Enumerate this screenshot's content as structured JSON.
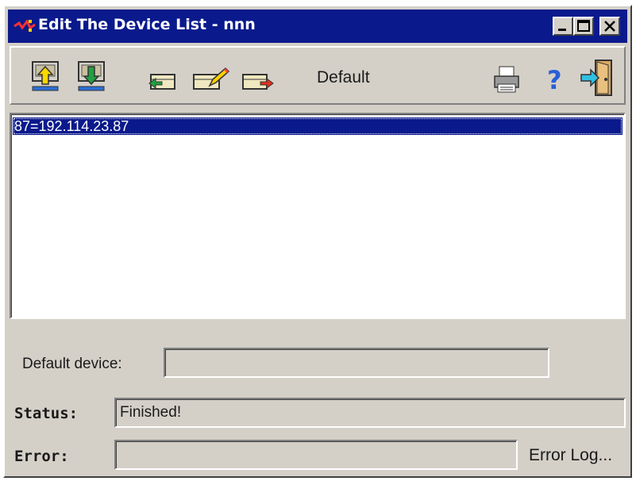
{
  "window": {
    "title": "Edit The Device List - nnn",
    "controls": {
      "minimize": "_",
      "maximize": "□",
      "close": "×"
    }
  },
  "toolbar": {
    "current_list": "Default",
    "icons": [
      "upload-icon",
      "download-icon",
      "add-device-icon",
      "edit-device-icon",
      "delete-device-icon",
      "print-icon",
      "help-icon",
      "exit-icon"
    ]
  },
  "device_list": {
    "items": [
      {
        "label": "87=192.114.23.87",
        "selected": true
      }
    ]
  },
  "form": {
    "default_device": {
      "label": "Default device:",
      "value": ""
    },
    "status": {
      "label": "Status:",
      "value": "Finished!"
    },
    "error": {
      "label": "Error:",
      "value": ""
    },
    "error_log_button": "Error Log..."
  },
  "colors": {
    "titlebar": "#0a1a8c",
    "selection": "#0a1a8c",
    "face": "#d4d0c8"
  }
}
